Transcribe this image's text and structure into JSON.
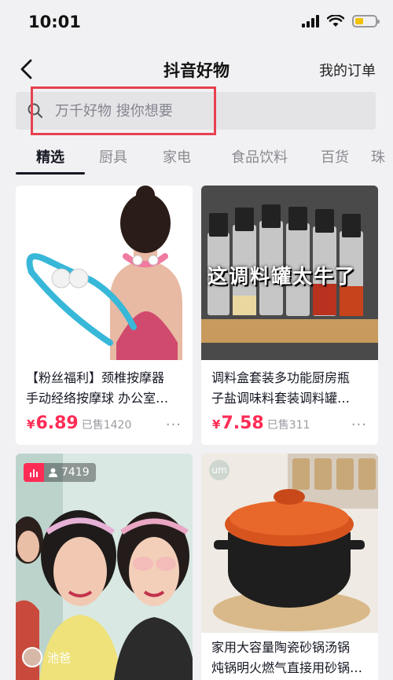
{
  "status_bar": {
    "time": "10:01"
  },
  "nav": {
    "title": "抖音好物",
    "orders": "我的订单"
  },
  "search": {
    "placeholder": "万千好物 搜你想要"
  },
  "tabs": [
    {
      "label": "精选",
      "active": true
    },
    {
      "label": "厨具",
      "active": false
    },
    {
      "label": "家电",
      "active": false
    },
    {
      "label": "食品饮料",
      "active": false
    },
    {
      "label": "百货",
      "active": false
    },
    {
      "label": "珠",
      "active": false
    }
  ],
  "products": [
    {
      "title_line1": "【粉丝福利】颈椎按摩器",
      "title_line2": "手动经络按摩球 办公室…",
      "currency": "¥",
      "price": "6.89",
      "sold": "已售1420",
      "more": "···"
    },
    {
      "overlay_text": "这调料罐太牛了",
      "title_line1": "调料盒套装多功能厨房瓶",
      "title_line2": "子盐调味料套装调料罐…",
      "currency": "¥",
      "price": "7.58",
      "sold": "已售311",
      "more": "···"
    },
    {
      "viewers": "7419",
      "author": "池爸"
    },
    {
      "logo_text": "um",
      "title_line1": "家用大容量陶瓷砂锅汤锅",
      "title_line2": "炖锅明火燃气直接用砂锅…"
    }
  ],
  "colors": {
    "accent": "#fe2c55",
    "highlight": "#e8404e",
    "background": "#f1f1f3"
  },
  "icons": [
    "back-icon",
    "search-icon",
    "wifi-icon",
    "signal-icon",
    "battery-icon",
    "more-icon",
    "live-icon",
    "user-icon"
  ]
}
